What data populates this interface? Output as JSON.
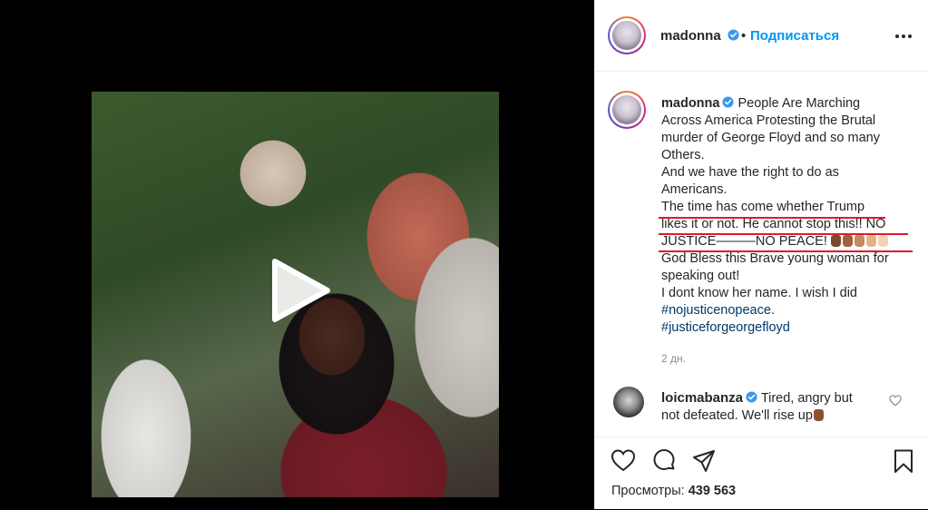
{
  "post": {
    "author": "madonna",
    "follow_label": "Подписаться",
    "dot": "•"
  },
  "caption": {
    "username": "madonna",
    "lines": [
      "People Are Marching",
      "Across America Protesting the Brutal",
      "murder of George Floyd and so many",
      "Others.",
      "And we have the right to do as",
      "Americans.",
      "The time has come whether Trump",
      "likes it or not. He cannot stop this!! NO",
      "JUSTICE———NO PEACE!",
      "God Bless this Brave young woman for",
      "speaking out!",
      "I dont know her name. I wish I did"
    ],
    "hashtags": [
      "#nojusticenopeace.",
      "#justiceforgeorgefloyd"
    ],
    "timestamp": "2 дн.",
    "fist_colors": [
      "#7a4a2a",
      "#a0623a",
      "#c68a5e",
      "#e2b48c",
      "#f4d2b4"
    ]
  },
  "comment": {
    "username": "loicmabanza",
    "text_line1": "Tired, angry but",
    "text_line2": "not defeated. We'll rise up",
    "fist_color": "#8a5233"
  },
  "stats": {
    "views_label": "Просмотры:",
    "views_value": "439 563"
  },
  "icons": {
    "like": "heart-icon",
    "comment": "comment-bubble-icon",
    "share": "paper-plane-icon",
    "save": "bookmark-icon",
    "play": "play-icon",
    "verified": "verified-badge-icon",
    "more": "more-options-icon"
  },
  "colors": {
    "link": "#0095f6",
    "hashtag": "#00376b",
    "underline": "#e0182d",
    "muted": "#8e8e8e",
    "verified": "#3897f0"
  }
}
